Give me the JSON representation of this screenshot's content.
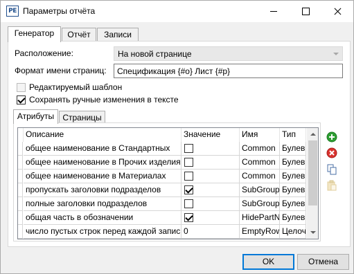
{
  "window": {
    "app_icon": "PE",
    "title": "Параметры отчёта"
  },
  "tabs": [
    {
      "label": "Генератор",
      "active": true
    },
    {
      "label": "Отчёт",
      "active": false
    },
    {
      "label": "Записи",
      "active": false
    }
  ],
  "generator": {
    "location_label": "Расположение:",
    "location_value": "На новой странице",
    "page_name_format_label": "Формат имени страниц:",
    "page_name_format_value": "Спецификация {#о} Лист {#р}",
    "editable_template_label": "Редактируемый шаблон",
    "editable_template_checked": false,
    "editable_template_enabled": false,
    "keep_manual_changes_label": "Сохранять ручные изменения в тексте",
    "keep_manual_changes_checked": true
  },
  "inner_tabs": [
    {
      "label": "Атрибуты",
      "active": true
    },
    {
      "label": "Страницы",
      "active": false
    }
  ],
  "attributes_table": {
    "columns": [
      "Описание",
      "Значение",
      "Имя",
      "Тип"
    ],
    "rows": [
      {
        "description": "общее наименование в Стандартных",
        "value_type": "checkbox",
        "checked": false,
        "name": "Common",
        "type": "Булевый"
      },
      {
        "description": "общее наименование в Прочих изделиях",
        "value_type": "checkbox",
        "checked": false,
        "name": "Common",
        "type": "Булевый"
      },
      {
        "description": "общее наименование в Материалах",
        "value_type": "checkbox",
        "checked": false,
        "name": "Common",
        "type": "Булевый"
      },
      {
        "description": "пропускать заголовки подразделов",
        "value_type": "checkbox",
        "checked": true,
        "name": "SubGroup",
        "type": "Булевый"
      },
      {
        "description": "полные заголовки подразделов",
        "value_type": "checkbox",
        "checked": false,
        "name": "SubGroup",
        "type": "Булевый"
      },
      {
        "description": "общая часть в обозначении",
        "value_type": "checkbox",
        "checked": true,
        "name": "HidePartN",
        "type": "Булевый"
      },
      {
        "description": "число пустых строк перед каждой записью",
        "value_type": "text",
        "value": "0",
        "name": "EmptyRow",
        "type": "Целочисленный"
      }
    ]
  },
  "side_buttons": [
    {
      "icon": "add-icon",
      "enabled": true
    },
    {
      "icon": "delete-icon",
      "enabled": true
    },
    {
      "icon": "copy-icon",
      "enabled": true
    },
    {
      "icon": "paste-icon",
      "enabled": false
    }
  ],
  "buttons": {
    "ok": "OK",
    "cancel": "Отмена"
  },
  "colors": {
    "accent": "#0078d7",
    "add": "#2e9e33",
    "delete": "#d9322e"
  }
}
